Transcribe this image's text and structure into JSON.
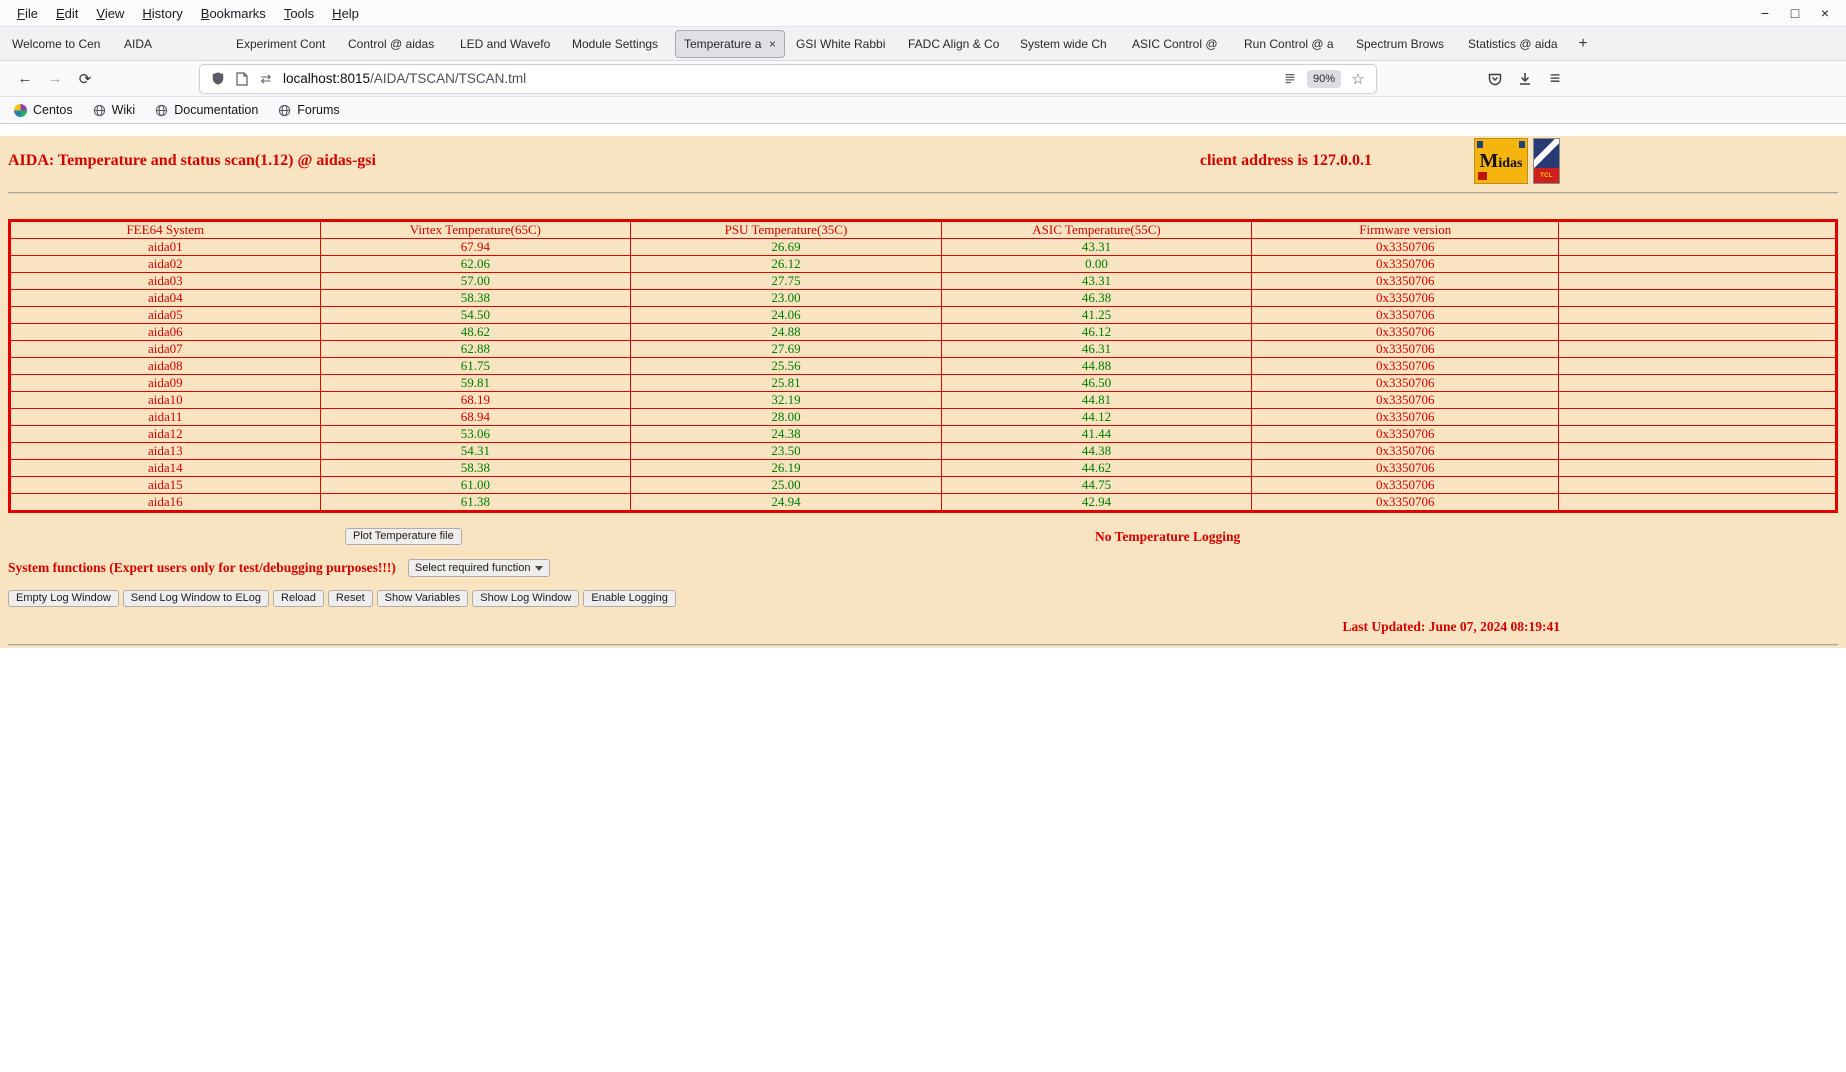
{
  "colors": {
    "red": "#d40000",
    "green": "#007c00",
    "page_bg": "#f8e4c0",
    "table_border": "#e00000"
  },
  "icons": {
    "back": "←",
    "forward": "→",
    "reload": "⟳",
    "swap": "⇄",
    "star": "☆",
    "menu": "≡",
    "minimize": "−",
    "maximize": "□",
    "close": "×",
    "close_tab": "×",
    "new_tab": "+"
  },
  "menubar": {
    "items": [
      "File",
      "Edit",
      "View",
      "History",
      "Bookmarks",
      "Tools",
      "Help"
    ]
  },
  "tabs": {
    "active_index": 6,
    "items": [
      {
        "label": "Welcome to Cen"
      },
      {
        "label": "AIDA"
      },
      {
        "label": "Experiment Cont"
      },
      {
        "label": "Control @ aidas"
      },
      {
        "label": "LED and Wavefo"
      },
      {
        "label": "Module Settings"
      },
      {
        "label": "Temperature a"
      },
      {
        "label": "GSI White Rabbi"
      },
      {
        "label": "FADC Align & Co"
      },
      {
        "label": "System wide Ch"
      },
      {
        "label": "ASIC Control @"
      },
      {
        "label": "Run Control @ a"
      },
      {
        "label": "Spectrum Brows"
      },
      {
        "label": "Statistics @ aida"
      }
    ]
  },
  "navbar": {
    "url_host": "localhost:8015",
    "url_path": "/AIDA/TSCAN/TSCAN.tml",
    "zoom": "90%"
  },
  "bookmarks": {
    "items": [
      {
        "label": "Centos",
        "icon": "centos"
      },
      {
        "label": "Wiki",
        "icon": "globe"
      },
      {
        "label": "Documentation",
        "icon": "globe"
      },
      {
        "label": "Forums",
        "icon": "globe"
      }
    ]
  },
  "page": {
    "title": "AIDA: Temperature and status scan(1.12) @ aidas-gsi",
    "client_address": "client address is 127.0.0.1",
    "logos": {
      "midas_text": "Midas",
      "tcl_text": "TCL"
    },
    "table": {
      "headers": [
        "FEE64 System",
        "Virtex Temperature(65C)",
        "PSU Temperature(35C)",
        "ASIC Temperature(55C)",
        "Firmware version"
      ],
      "thresholds": {
        "virtex": 65,
        "psu": 35,
        "asic": 55
      },
      "rows": [
        {
          "name": "aida01",
          "virtex": "67.94",
          "psu": "26.69",
          "asic": "43.31",
          "firmware": "0x3350706"
        },
        {
          "name": "aida02",
          "virtex": "62.06",
          "psu": "26.12",
          "asic": "0.00",
          "firmware": "0x3350706"
        },
        {
          "name": "aida03",
          "virtex": "57.00",
          "psu": "27.75",
          "asic": "43.31",
          "firmware": "0x3350706"
        },
        {
          "name": "aida04",
          "virtex": "58.38",
          "psu": "23.00",
          "asic": "46.38",
          "firmware": "0x3350706"
        },
        {
          "name": "aida05",
          "virtex": "54.50",
          "psu": "24.06",
          "asic": "41.25",
          "firmware": "0x3350706"
        },
        {
          "name": "aida06",
          "virtex": "48.62",
          "psu": "24.88",
          "asic": "46.12",
          "firmware": "0x3350706"
        },
        {
          "name": "aida07",
          "virtex": "62.88",
          "psu": "27.69",
          "asic": "46.31",
          "firmware": "0x3350706"
        },
        {
          "name": "aida08",
          "virtex": "61.75",
          "psu": "25.56",
          "asic": "44.88",
          "firmware": "0x3350706"
        },
        {
          "name": "aida09",
          "virtex": "59.81",
          "psu": "25.81",
          "asic": "46.50",
          "firmware": "0x3350706"
        },
        {
          "name": "aida10",
          "virtex": "68.19",
          "psu": "32.19",
          "asic": "44.81",
          "firmware": "0x3350706"
        },
        {
          "name": "aida11",
          "virtex": "68.94",
          "psu": "28.00",
          "asic": "44.12",
          "firmware": "0x3350706"
        },
        {
          "name": "aida12",
          "virtex": "53.06",
          "psu": "24.38",
          "asic": "41.44",
          "firmware": "0x3350706"
        },
        {
          "name": "aida13",
          "virtex": "54.31",
          "psu": "23.50",
          "asic": "44.38",
          "firmware": "0x3350706"
        },
        {
          "name": "aida14",
          "virtex": "58.38",
          "psu": "26.19",
          "asic": "44.62",
          "firmware": "0x3350706"
        },
        {
          "name": "aida15",
          "virtex": "61.00",
          "psu": "25.00",
          "asic": "44.75",
          "firmware": "0x3350706"
        },
        {
          "name": "aida16",
          "virtex": "61.38",
          "psu": "24.94",
          "asic": "42.94",
          "firmware": "0x3350706"
        }
      ]
    },
    "plot_button": "Plot Temperature file",
    "logging_status": "No Temperature Logging",
    "system_functions_label": "System functions (Expert users only for test/debugging purposes!!!)",
    "function_select": "Select required function",
    "action_buttons": [
      "Empty Log Window",
      "Send Log Window to ELog",
      "Reload",
      "Reset",
      "Show Variables",
      "Show Log Window",
      "Enable Logging"
    ],
    "last_updated": "Last Updated: June 07, 2024 08:19:41"
  }
}
